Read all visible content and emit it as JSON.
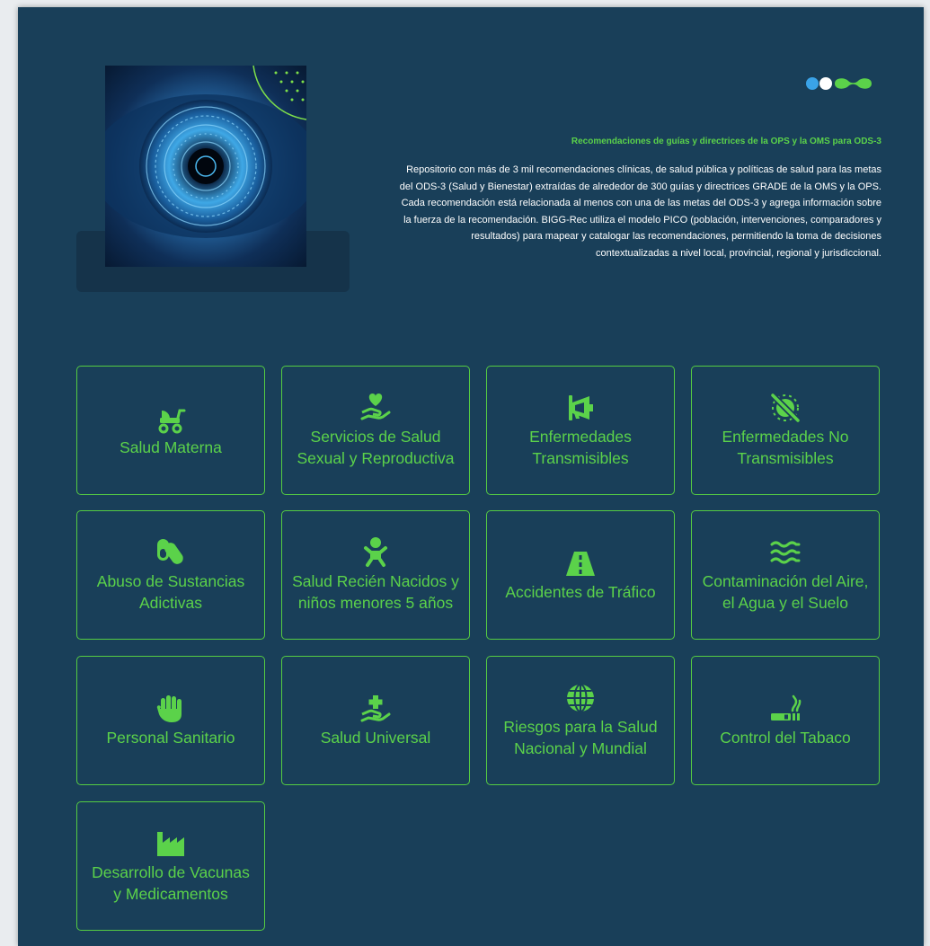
{
  "intro": {
    "subtitle": "Recomendaciones de guías y directrices de la OPS y la OMS para ODS-3",
    "description": "Repositorio con más de 3 mil recomendaciones clínicas, de salud pública y políticas de salud para las metas del ODS-3 (Salud y Bienestar) extraídas de alrededor de 300 guías y directrices GRADE de la OMS y la OPS. Cada recomendación está relacionada al menos con una de las metas del ODS-3 y agrega información sobre la fuerza de la recomendación. BIGG-Rec utiliza el modelo PICO (población, intervenciones, comparadores y resultados) para mapear y catalogar las recomendaciones, permitiendo la toma de decisiones contextualizadas a nivel local, provincial, regional y jurisdiccional."
  },
  "colors": {
    "background": "#193f59",
    "accent_green": "#5bd24a",
    "logo_blue": "#3aa3e8",
    "logo_white": "#ffffff"
  },
  "categories": [
    {
      "label": "Salud Materna",
      "icon": "baby-stroller-icon"
    },
    {
      "label": "Servicios de Salud Sexual y Reproductiva",
      "icon": "hand-heart-icon"
    },
    {
      "label": "Enfermedades Transmisibles",
      "icon": "megaphone-icon"
    },
    {
      "label": "Enfermedades No Transmisibles",
      "icon": "no-virus-icon"
    },
    {
      "label": "Abuso de Sustancias Adictivas",
      "icon": "pills-icon"
    },
    {
      "label": "Salud Recién Nacidos y niños menores 5 años",
      "icon": "baby-icon"
    },
    {
      "label": "Accidentes de Tráfico",
      "icon": "road-icon"
    },
    {
      "label": "Contaminación del Aire, el Agua y el Suelo",
      "icon": "water-waves-icon"
    },
    {
      "label": "Personal Sanitario",
      "icon": "hand-icon"
    },
    {
      "label": "Salud Universal",
      "icon": "hand-medical-icon"
    },
    {
      "label": "Riesgos para la Salud Nacional y Mundial",
      "icon": "globe-icon"
    },
    {
      "label": "Control del Tabaco",
      "icon": "smoking-icon"
    },
    {
      "label": "Desarrollo de Vacunas y Medicamentos",
      "icon": "factory-icon"
    }
  ]
}
